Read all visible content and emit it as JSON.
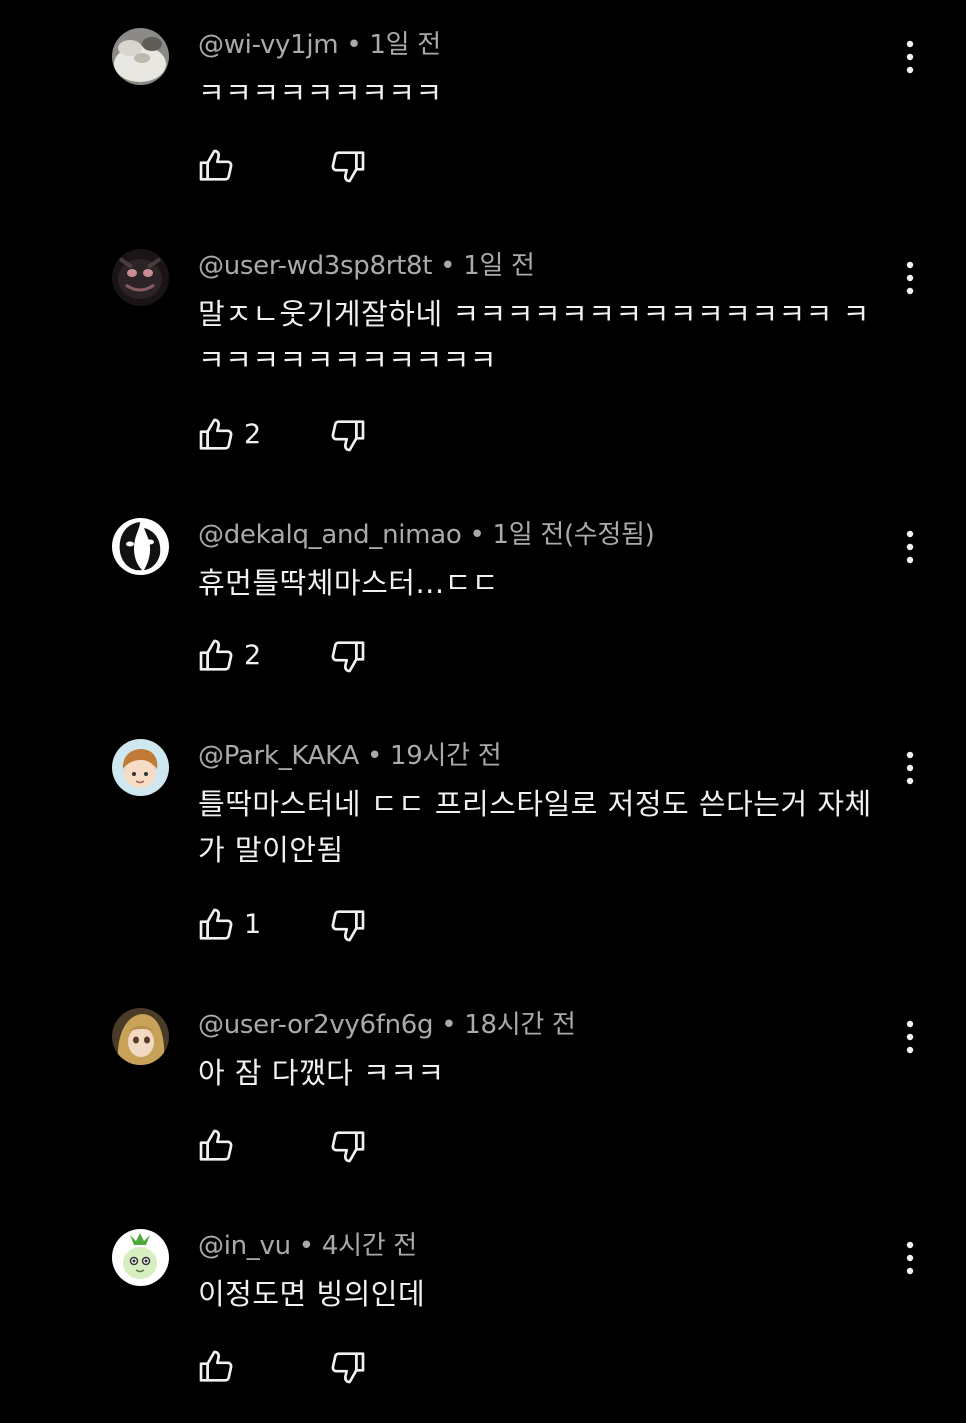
{
  "comments": [
    {
      "author": "@wi-vy1jm",
      "separator": "•",
      "time": "1일 전",
      "text": "ㅋㅋㅋㅋㅋㅋㅋㅋㅋ",
      "likes": "",
      "avatar_icon": "cat-photo-avatar"
    },
    {
      "author": "@user-wd3sp8rt8t",
      "separator": "•",
      "time": "1일 전",
      "text": "말ㅈㄴ웃기게잘하네 ㅋㅋㅋㅋㅋㅋㅋㅋㅋㅋㅋㅋㅋㅋ ㅋㅋㅋㅋㅋㅋㅋㅋㅋㅋㅋㅋ",
      "likes": "2",
      "avatar_icon": "dark-character-avatar"
    },
    {
      "author": "@dekalq_and_nimao",
      "separator": "•",
      "time": "1일 전(수정됨)",
      "text": "휴먼틀딱체마스터...ㄷㄷ",
      "likes": "2",
      "avatar_icon": "theater-mask-avatar"
    },
    {
      "author": "@Park_KAKA",
      "separator": "•",
      "time": "19시간 전",
      "text": "틀딱마스터네 ㄷㄷ 프리스타일로 저정도 쓴다는거 자체가 말이안됨",
      "likes": "1",
      "avatar_icon": "cartoon-boy-avatar"
    },
    {
      "author": "@user-or2vy6fn6g",
      "separator": "•",
      "time": "18시간 전",
      "text": "아 잠 다깼다 ㅋㅋㅋ",
      "likes": "",
      "avatar_icon": "doll-avatar"
    },
    {
      "author": "@in_vu",
      "separator": "•",
      "time": "4시간 전",
      "text": "이정도면 빙의인데",
      "likes": "",
      "avatar_icon": "green-radish-avatar"
    }
  ],
  "icons": {
    "like": "thumbs-up-icon",
    "dislike": "thumbs-down-icon",
    "more": "more-vertical-icon"
  },
  "colors": {
    "background": "#000000",
    "text_primary": "#f1f1f1",
    "text_secondary": "#aaaaaa"
  }
}
